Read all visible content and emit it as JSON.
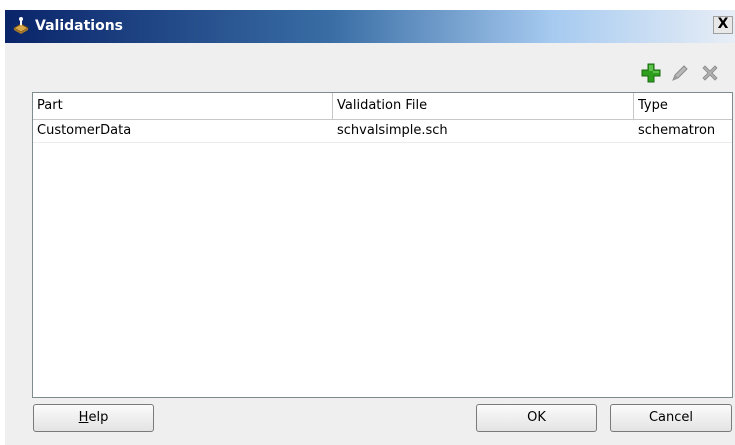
{
  "window": {
    "title": "Validations",
    "close_label": "X"
  },
  "toolbar": {
    "add_icon": "plus-icon",
    "edit_icon": "pencil-icon",
    "delete_icon": "delete-x-icon",
    "add_color": "#2e9e1f"
  },
  "table": {
    "columns": [
      "Part",
      "Validation File",
      "Type"
    ],
    "rows": [
      [
        "CustomerData",
        "schvalsimple.sch",
        "schematron"
      ]
    ]
  },
  "buttons": {
    "help_label": "Help",
    "help_mnemonic": "H",
    "help_rest": "elp",
    "ok_label": "OK",
    "cancel_label": "Cancel"
  }
}
